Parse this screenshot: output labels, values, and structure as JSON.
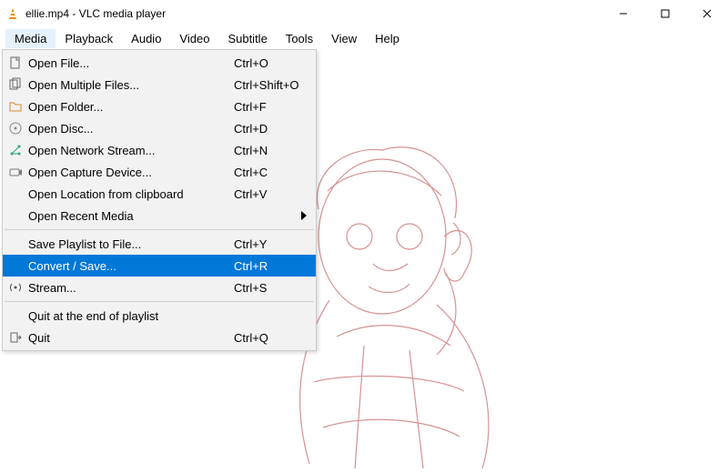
{
  "titlebar": {
    "title": "ellie.mp4 - VLC media player"
  },
  "menubar": {
    "items": [
      "Media",
      "Playback",
      "Audio",
      "Video",
      "Subtitle",
      "Tools",
      "View",
      "Help"
    ],
    "open_index": 0
  },
  "media_menu": {
    "groups": [
      [
        {
          "icon": "file-icon",
          "label": "Open File...",
          "shortcut": "Ctrl+O"
        },
        {
          "icon": "files-icon",
          "label": "Open Multiple Files...",
          "shortcut": "Ctrl+Shift+O"
        },
        {
          "icon": "folder-icon",
          "label": "Open Folder...",
          "shortcut": "Ctrl+F"
        },
        {
          "icon": "disc-icon",
          "label": "Open Disc...",
          "shortcut": "Ctrl+D"
        },
        {
          "icon": "network-icon",
          "label": "Open Network Stream...",
          "shortcut": "Ctrl+N"
        },
        {
          "icon": "capture-icon",
          "label": "Open Capture Device...",
          "shortcut": "Ctrl+C"
        },
        {
          "icon": "",
          "label": "Open Location from clipboard",
          "shortcut": "Ctrl+V"
        },
        {
          "icon": "",
          "label": "Open Recent Media",
          "shortcut": "",
          "submenu": true
        }
      ],
      [
        {
          "icon": "",
          "label": "Save Playlist to File...",
          "shortcut": "Ctrl+Y"
        },
        {
          "icon": "",
          "label": "Convert / Save...",
          "shortcut": "Ctrl+R",
          "highlight": true
        },
        {
          "icon": "stream-icon",
          "label": "Stream...",
          "shortcut": "Ctrl+S"
        }
      ],
      [
        {
          "icon": "",
          "label": "Quit at the end of playlist",
          "shortcut": ""
        },
        {
          "icon": "quit-icon",
          "label": "Quit",
          "shortcut": "Ctrl+Q"
        }
      ]
    ]
  }
}
